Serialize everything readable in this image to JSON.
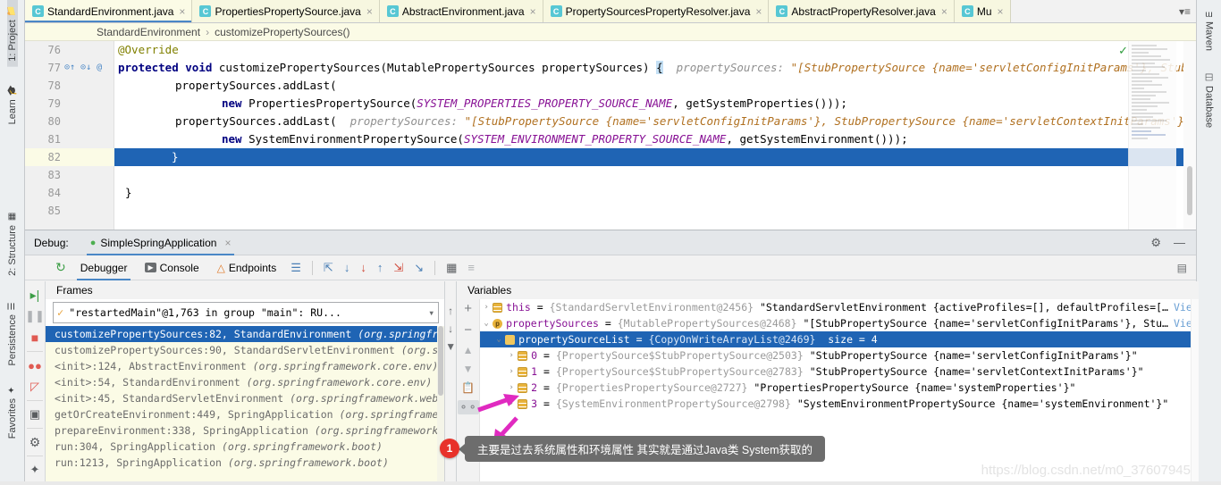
{
  "left_strip": [
    {
      "label": "1: Project",
      "icon": "folder-icon",
      "active": true
    },
    {
      "label": "Learn",
      "icon": "graduation-icon",
      "active": false
    },
    {
      "label": "2: Structure",
      "icon": "structure-icon",
      "active": false
    },
    {
      "label": "Persistence",
      "icon": "persistence-icon",
      "active": false
    },
    {
      "label": "Favorites",
      "icon": "star-icon",
      "active": false
    }
  ],
  "right_strip": [
    {
      "label": "Maven",
      "icon": "maven-icon"
    },
    {
      "label": "Database",
      "icon": "database-icon"
    }
  ],
  "tabs": [
    {
      "label": "StandardEnvironment.java",
      "icon": "class-icon",
      "active": true
    },
    {
      "label": "PropertiesPropertySource.java",
      "icon": "class-icon",
      "active": false
    },
    {
      "label": "AbstractEnvironment.java",
      "icon": "class-icon",
      "active": false
    },
    {
      "label": "PropertySourcesPropertyResolver.java",
      "icon": "class-icon",
      "active": false
    },
    {
      "label": "AbstractPropertyResolver.java",
      "icon": "class-icon",
      "active": false
    },
    {
      "label": "Mu",
      "icon": "class-icon",
      "active": false
    }
  ],
  "tabbar_overflow": "▾≡",
  "breadcrumb": {
    "class": "StandardEnvironment",
    "separator": "›",
    "method": "customizePropertySources()"
  },
  "editor": {
    "inspection_status": "✓",
    "lines": [
      {
        "num": "76",
        "gutter": "",
        "highlight": false,
        "selected": false
      },
      {
        "num": "77",
        "gutter": "⊙↑ ⊙↓ @",
        "highlight": false,
        "selected": false
      },
      {
        "num": "78",
        "gutter": "",
        "highlight": false,
        "selected": false
      },
      {
        "num": "79",
        "gutter": "",
        "highlight": false,
        "selected": false
      },
      {
        "num": "80",
        "gutter": "",
        "highlight": false,
        "selected": false
      },
      {
        "num": "81",
        "gutter": "",
        "highlight": false,
        "selected": false
      },
      {
        "num": "82",
        "gutter": "",
        "highlight": true,
        "selected": true
      },
      {
        "num": "83",
        "gutter": "",
        "highlight": false,
        "selected": false
      },
      {
        "num": "84",
        "gutter": "",
        "highlight": false,
        "selected": false
      },
      {
        "num": "85",
        "gutter": "",
        "highlight": false,
        "selected": false
      }
    ],
    "code": {
      "l76_annotation": "@Override",
      "l77_kw1": "protected",
      "l77_kw2": "void",
      "l77_sig": " customizePropertySources(MutablePropertySources propertySources) ",
      "l77_brace": "{",
      "l77_hint_label": "  propertySources:",
      "l77_hint_value": " \"[StubPropertySource {name='servletConfigInitParams'}, StubProper",
      "l78": "propertySources.addLast(",
      "l79_kw": "new",
      "l79_call": " PropertiesPropertySource(",
      "l79_const": "SYSTEM_PROPERTIES_PROPERTY_SOURCE_NAME",
      "l79_rest": ", getSystemProperties()));",
      "l80_call": "propertySources.addLast(",
      "l80_hint_label": "  propertySources:",
      "l80_hint_value": " \"[StubPropertySource {name='servletConfigInitParams'}, StubPropertySource {name='servletContextInitParams'}, Propertie",
      "l81_kw": "new",
      "l81_call": " SystemEnvironmentPropertySource(",
      "l81_const": "SYSTEM_ENVIRONMENT_PROPERTY_SOURCE_NAME",
      "l81_rest": ", getSystemEnvironment()));",
      "l82": "}",
      "l84": "}"
    }
  },
  "debug": {
    "label": "Debug:",
    "run_config": "SimpleSpringApplication",
    "close": "×",
    "settings_icon": "gear-icon",
    "minimize_icon": "minimize-icon",
    "tabs": [
      {
        "label": "Debugger",
        "icon": "debugger-icon",
        "active": true
      },
      {
        "label": "Console",
        "icon": "console-icon",
        "active": false
      },
      {
        "label": "Endpoints",
        "icon": "endpoints-icon",
        "active": false
      }
    ],
    "toolbar_icons": [
      "layout-icon",
      "step-over-icon",
      "step-into-icon",
      "force-step-into-icon",
      "step-out-icon",
      "run-to-cursor-icon",
      "drop-frame-icon",
      "evaluate-icon",
      "settings2-icon"
    ],
    "side_icons": [
      "resume-icon",
      "pause-icon",
      "stop-icon",
      "view-breakpoints-icon",
      "mute-breakpoints-icon",
      "snapshot-icon",
      "settings-gear-icon",
      "pin-icon"
    ],
    "frames": {
      "title": "Frames",
      "thread": "\"restartedMain\"@1,763 in group \"main\": RU...",
      "thread_check": "✓",
      "buttons": [
        "up-arrow-icon",
        "down-arrow-icon",
        "filter-icon"
      ],
      "items": [
        {
          "text": "customizePropertySources:82, StandardEnvironment",
          "pkg": " (org.springfr",
          "selected": true
        },
        {
          "text": "customizePropertySources:90, StandardServletEnvironment",
          "pkg": " (org.sp",
          "selected": false
        },
        {
          "text": "<init>:124, AbstractEnvironment",
          "pkg": " (org.springframework.core.env)",
          "selected": false
        },
        {
          "text": "<init>:54, StandardEnvironment",
          "pkg": " (org.springframework.core.env)",
          "selected": false
        },
        {
          "text": "<init>:45, StandardServletEnvironment",
          "pkg": " (org.springframework.web",
          "selected": false
        },
        {
          "text": "getOrCreateEnvironment:449, SpringApplication",
          "pkg": " (org.springframe",
          "selected": false
        },
        {
          "text": "prepareEnvironment:338, SpringApplication",
          "pkg": " (org.springframework",
          "selected": false
        },
        {
          "text": "run:304, SpringApplication",
          "pkg": " (org.springframework.boot)",
          "selected": false
        },
        {
          "text": "run:1213, SpringApplication",
          "pkg": " (org.springframework.boot)",
          "selected": false
        }
      ]
    },
    "variables": {
      "title": "Variables",
      "buttons": [
        "add-icon",
        "remove-icon",
        "move-up-icon",
        "move-down-icon",
        "copy-icon",
        "watches-icon"
      ],
      "rows": [
        {
          "indent": 0,
          "tri": "›",
          "icon": "list",
          "name": "this",
          "ref": "{StandardServletEnvironment@2456}",
          "value": "\"StandardServletEnvironment {activeProfiles=[], defaultProfiles=[…",
          "link": "View",
          "selected": false
        },
        {
          "indent": 0,
          "tri": "⌄",
          "icon": "p",
          "name": "propertySources",
          "ref": "{MutablePropertySources@2468}",
          "value": "\"[StubPropertySource {name='servletConfigInitParams'}, Stu…",
          "link": "View",
          "selected": false
        },
        {
          "indent": 1,
          "tri": "⌄",
          "icon": "field",
          "name": "propertySourceList",
          "ref": "{CopyOnWriteArrayList@2469}",
          "value": "size = 4",
          "link": "",
          "selected": true
        },
        {
          "indent": 2,
          "tri": "›",
          "icon": "list",
          "name": "0",
          "ref": "{PropertySource$StubPropertySource@2503}",
          "value": "\"StubPropertySource {name='servletConfigInitParams'}\"",
          "link": "",
          "selected": false
        },
        {
          "indent": 2,
          "tri": "›",
          "icon": "list",
          "name": "1",
          "ref": "{PropertySource$StubPropertySource@2783}",
          "value": "\"StubPropertySource {name='servletContextInitParams'}\"",
          "link": "",
          "selected": false
        },
        {
          "indent": 2,
          "tri": "›",
          "icon": "list",
          "name": "2",
          "ref": "{PropertiesPropertySource@2727}",
          "value": "\"PropertiesPropertySource {name='systemProperties'}\"",
          "link": "",
          "selected": false
        },
        {
          "indent": 2,
          "tri": "›",
          "icon": "list",
          "name": "3",
          "ref": "{SystemEnvironmentPropertySource@2798}",
          "value": "\"SystemEnvironmentPropertySource {name='systemEnvironment'}\"",
          "link": "",
          "selected": false
        }
      ]
    }
  },
  "annotation": {
    "badge": "1",
    "tooltip": "主要是过去系统属性和环境属性 其实就是通过Java类 System获取的",
    "arrow_color": "#e02ac0"
  },
  "watermark": "https://blog.csdn.net/m0_37607945",
  "colors": {
    "accent": "#4a87c6",
    "selection": "#1f64b4",
    "tab_bg": "#fbfbe6",
    "keyword": "#000080",
    "annotation": "#808000",
    "constant": "#871094",
    "hint": "#909090",
    "hint_value": "#b07020"
  }
}
